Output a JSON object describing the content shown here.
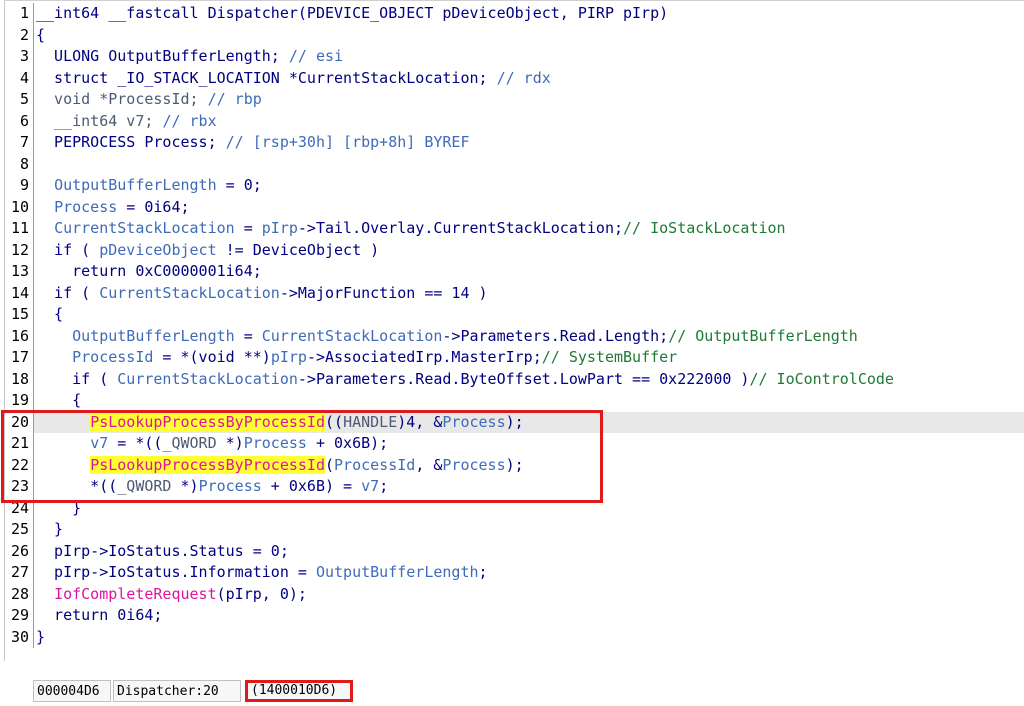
{
  "editor": {
    "lines": [
      {
        "n": "1",
        "tokens": [
          [
            "__int64 __fastcall Dispatcher(PDEVICE_OBJECT pDeviceObject, PIRP pIrp)",
            "plain"
          ]
        ]
      },
      {
        "n": "2",
        "tokens": [
          [
            "{",
            "plain"
          ]
        ]
      },
      {
        "n": "3",
        "tokens": [
          [
            "  ULONG OutputBufferLength; ",
            "plain"
          ],
          [
            "// esi",
            "var"
          ]
        ]
      },
      {
        "n": "4",
        "tokens": [
          [
            "  struct _IO_STACK_LOCATION *CurrentStackLocation; ",
            "plain"
          ],
          [
            "// rdx",
            "var"
          ]
        ]
      },
      {
        "n": "5",
        "tokens": [
          [
            "  void *ProcessId; ",
            "type"
          ],
          [
            "// rbp",
            "var"
          ]
        ]
      },
      {
        "n": "6",
        "tokens": [
          [
            "  __int64 v7; ",
            "type"
          ],
          [
            "// rbx",
            "var"
          ]
        ]
      },
      {
        "n": "7",
        "tokens": [
          [
            "  PEPROCESS Process; ",
            "plain"
          ],
          [
            "// [rsp+30h] [rbp+8h] BYREF",
            "var"
          ]
        ]
      },
      {
        "n": "8",
        "tokens": []
      },
      {
        "n": "9",
        "tokens": [
          [
            "  ",
            "plain"
          ],
          [
            "OutputBufferLength",
            "var"
          ],
          [
            " = 0;",
            "plain"
          ]
        ]
      },
      {
        "n": "10",
        "tokens": [
          [
            "  ",
            "plain"
          ],
          [
            "Process",
            "var"
          ],
          [
            " = 0i64;",
            "plain"
          ]
        ]
      },
      {
        "n": "11",
        "tokens": [
          [
            "  ",
            "plain"
          ],
          [
            "CurrentStackLocation",
            "var"
          ],
          [
            " = ",
            "plain"
          ],
          [
            "pIrp",
            "var"
          ],
          [
            "->Tail.Overlay.CurrentStackLocation;",
            "plain"
          ],
          [
            "// IoStackLocation",
            "com"
          ]
        ]
      },
      {
        "n": "12",
        "tokens": [
          [
            "  if ( ",
            "plain"
          ],
          [
            "pDeviceObject",
            "var"
          ],
          [
            " != DeviceObject )",
            "plain"
          ]
        ]
      },
      {
        "n": "13",
        "tokens": [
          [
            "    return 0xC0000001i64;",
            "plain"
          ]
        ]
      },
      {
        "n": "14",
        "tokens": [
          [
            "  if ( ",
            "plain"
          ],
          [
            "CurrentStackLocation",
            "var"
          ],
          [
            "->MajorFunction == 14 )",
            "plain"
          ]
        ]
      },
      {
        "n": "15",
        "tokens": [
          [
            "  {",
            "plain"
          ]
        ]
      },
      {
        "n": "16",
        "tokens": [
          [
            "    ",
            "plain"
          ],
          [
            "OutputBufferLength",
            "var"
          ],
          [
            " = ",
            "plain"
          ],
          [
            "CurrentStackLocation",
            "var"
          ],
          [
            "->Parameters.Read.Length;",
            "plain"
          ],
          [
            "// OutputBufferLength",
            "com"
          ]
        ]
      },
      {
        "n": "17",
        "tokens": [
          [
            "    ",
            "plain"
          ],
          [
            "ProcessId",
            "var"
          ],
          [
            " = *(void **)",
            "plain"
          ],
          [
            "pIrp",
            "var"
          ],
          [
            "->AssociatedIrp.MasterIrp;",
            "plain"
          ],
          [
            "// SystemBuffer",
            "com"
          ]
        ]
      },
      {
        "n": "18",
        "tokens": [
          [
            "    if ( ",
            "plain"
          ],
          [
            "CurrentStackLocation",
            "var"
          ],
          [
            "->Parameters.Read.ByteOffset.LowPart == 0x222000 )",
            "plain"
          ],
          [
            "// IoControlCode",
            "com"
          ]
        ]
      },
      {
        "n": "19",
        "tokens": [
          [
            "    {",
            "plain"
          ]
        ]
      },
      {
        "n": "20",
        "cur": true,
        "tokens": [
          [
            "      ",
            "plain"
          ],
          [
            "PsLookupProcessByProcessId",
            "funchl"
          ],
          [
            "((",
            "plain"
          ],
          [
            "HANDLE",
            "type"
          ],
          [
            ")4, &",
            "plain"
          ],
          [
            "Process",
            "var"
          ],
          [
            ");",
            "plain"
          ]
        ]
      },
      {
        "n": "21",
        "tokens": [
          [
            "      ",
            "plain"
          ],
          [
            "v7",
            "var"
          ],
          [
            " = *((",
            "plain"
          ],
          [
            "_QWORD",
            "type"
          ],
          [
            " *)",
            "plain"
          ],
          [
            "Process",
            "var"
          ],
          [
            " + 0x6B);",
            "plain"
          ]
        ]
      },
      {
        "n": "22",
        "tokens": [
          [
            "      ",
            "plain"
          ],
          [
            "PsLookupProcessByProcessId",
            "funchl"
          ],
          [
            "(",
            "plain"
          ],
          [
            "ProcessId",
            "var"
          ],
          [
            ", &",
            "plain"
          ],
          [
            "Process",
            "var"
          ],
          [
            ");",
            "plain"
          ]
        ]
      },
      {
        "n": "23",
        "tokens": [
          [
            "      *((",
            "plain"
          ],
          [
            "_QWORD",
            "type"
          ],
          [
            " *)",
            "plain"
          ],
          [
            "Process",
            "var"
          ],
          [
            " + 0x6B) = ",
            "plain"
          ],
          [
            "v7",
            "var"
          ],
          [
            ";",
            "plain"
          ]
        ]
      },
      {
        "n": "24",
        "tokens": [
          [
            "    }",
            "plain"
          ]
        ]
      },
      {
        "n": "25",
        "tokens": [
          [
            "  }",
            "plain"
          ]
        ]
      },
      {
        "n": "26",
        "tokens": [
          [
            "  pIrp->IoStatus.Status = 0;",
            "plain"
          ]
        ]
      },
      {
        "n": "27",
        "tokens": [
          [
            "  pIrp->IoStatus.Information = ",
            "plain"
          ],
          [
            "OutputBufferLength",
            "var"
          ],
          [
            ";",
            "plain"
          ]
        ]
      },
      {
        "n": "28",
        "tokens": [
          [
            "  ",
            "plain"
          ],
          [
            "IofCompleteRequest",
            "func"
          ],
          [
            "(pIrp, 0);",
            "plain"
          ]
        ]
      },
      {
        "n": "29",
        "tokens": [
          [
            "  return 0i64;",
            "plain"
          ]
        ]
      },
      {
        "n": "30",
        "tokens": [
          [
            "}",
            "plain"
          ]
        ]
      }
    ]
  },
  "status": {
    "offset": "000004D6",
    "location": "Dispatcher:20",
    "address": "(1400010D6)"
  },
  "colors": {
    "highlight_box": "#e01a1a",
    "func_highlight": "#ffff33",
    "function": "#e0139e",
    "comment": "#1f7a35",
    "variable": "#3f6bb8"
  }
}
